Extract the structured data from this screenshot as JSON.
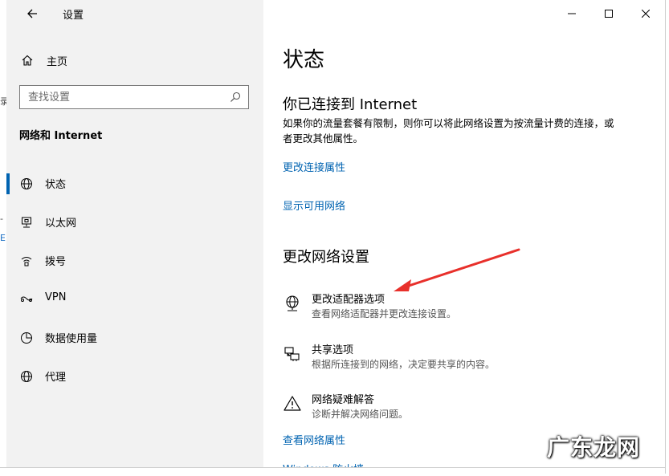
{
  "window": {
    "title": "设置",
    "controls": {
      "minimize": "minimize-icon",
      "maximize": "maximize-icon",
      "close": "close-icon"
    }
  },
  "sidebar": {
    "home_label": "主页",
    "search_placeholder": "查找设置",
    "section_label": "网络和 Internet",
    "items": [
      {
        "label": "状态",
        "icon": "globe-icon",
        "active": true
      },
      {
        "label": "以太网",
        "icon": "ethernet-icon",
        "active": false
      },
      {
        "label": "拨号",
        "icon": "dialup-icon",
        "active": false
      },
      {
        "label": "VPN",
        "icon": "vpn-icon",
        "active": false
      },
      {
        "label": "数据使用量",
        "icon": "data-usage-icon",
        "active": false
      },
      {
        "label": "代理",
        "icon": "globe-icon",
        "active": false
      }
    ]
  },
  "main": {
    "page_title": "状态",
    "connected_heading": "你已连接到 Internet",
    "connected_desc": "如果你的流量套餐有限制，则你可以将此网络设置为按流量计费的连接，或者更改其他属性。",
    "link_change_connection_props": "更改连接属性",
    "link_show_networks": "显示可用网络",
    "change_settings_heading": "更改网络设置",
    "options": [
      {
        "title": "更改适配器选项",
        "desc": "查看网络适配器并更改连接设置。",
        "icon": "adapter-icon"
      },
      {
        "title": "共享选项",
        "desc": "根据所连接到的网络，决定要共享的内容。",
        "icon": "sharing-icon"
      },
      {
        "title": "网络疑难解答",
        "desc": "诊断并解决网络问题。",
        "icon": "warning-icon"
      }
    ],
    "link_view_network_props": "查看网络属性",
    "link_windows_firewall": "Windows 防火墙"
  },
  "annotation": {
    "arrow_color": "#e8302b"
  },
  "watermark": "广东龙网",
  "colors": {
    "accent": "#0063b1",
    "sidebar_bg": "#f2f2f2"
  }
}
